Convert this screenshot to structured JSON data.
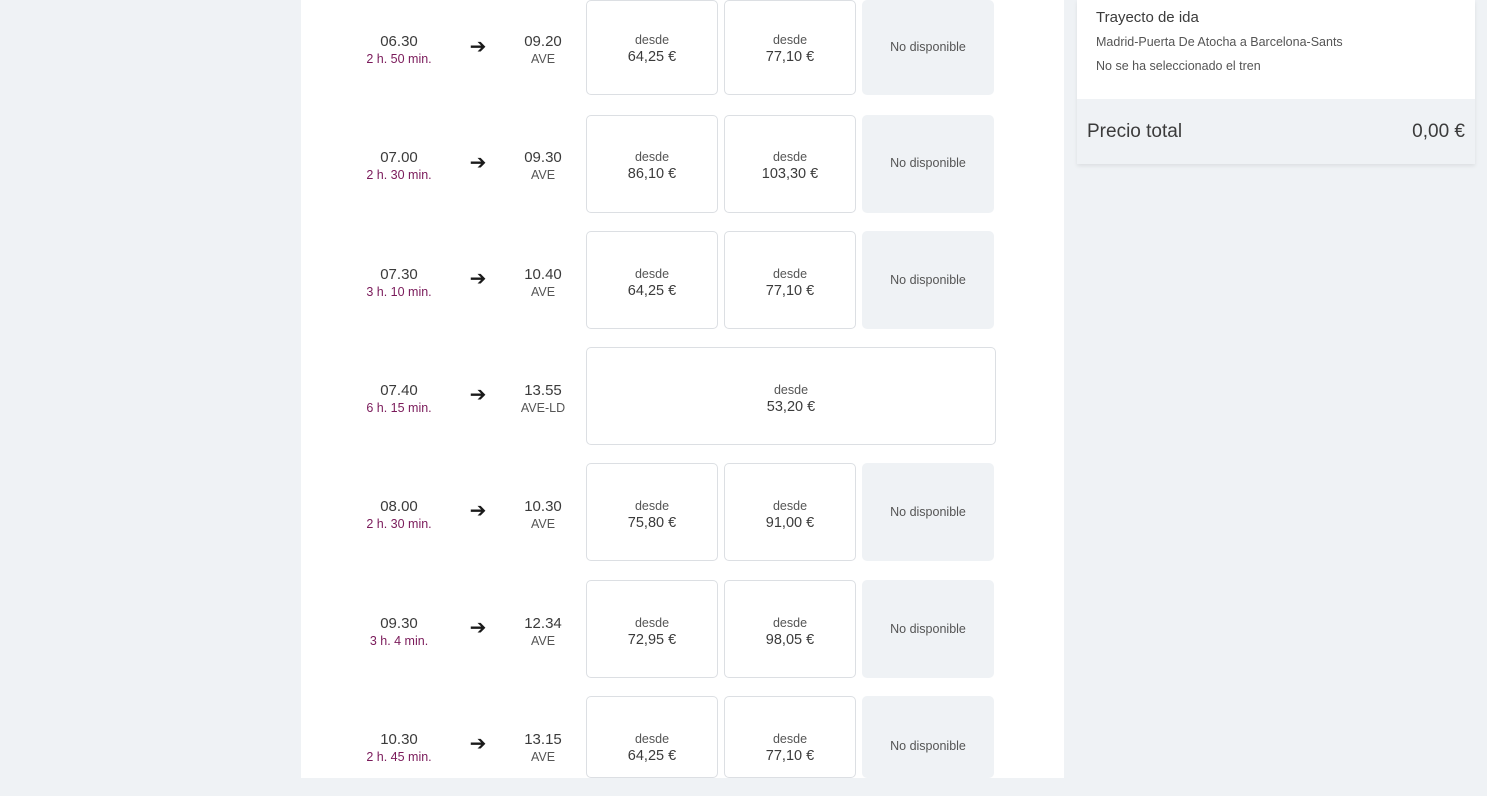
{
  "results": {
    "trips": [
      {
        "departure": "06.30",
        "duration": "2 h. 50 min.",
        "arrival": "09.20",
        "train": "AVE",
        "fares": [
          {
            "label": "desde",
            "price": "64,25 €"
          },
          {
            "label": "desde",
            "price": "77,10 €"
          },
          {
            "unavailable": "No disponible"
          }
        ]
      },
      {
        "departure": "07.00",
        "duration": "2 h. 30 min.",
        "arrival": "09.30",
        "train": "AVE",
        "fares": [
          {
            "label": "desde",
            "price": "86,10 €"
          },
          {
            "label": "desde",
            "price": "103,30 €"
          },
          {
            "unavailable": "No disponible"
          }
        ]
      },
      {
        "departure": "07.30",
        "duration": "3 h. 10 min.",
        "arrival": "10.40",
        "train": "AVE",
        "fares": [
          {
            "label": "desde",
            "price": "64,25 €"
          },
          {
            "label": "desde",
            "price": "77,10 €"
          },
          {
            "unavailable": "No disponible"
          }
        ]
      },
      {
        "departure": "07.40",
        "duration": "6 h. 15 min.",
        "arrival": "13.55",
        "train": "AVE-LD",
        "fares": [
          {
            "label": "desde",
            "price": "53,20 €"
          }
        ]
      },
      {
        "departure": "08.00",
        "duration": "2 h. 30 min.",
        "arrival": "10.30",
        "train": "AVE",
        "fares": [
          {
            "label": "desde",
            "price": "75,80 €"
          },
          {
            "label": "desde",
            "price": "91,00 €"
          },
          {
            "unavailable": "No disponible"
          }
        ]
      },
      {
        "departure": "09.30",
        "duration": "3 h. 4 min.",
        "arrival": "12.34",
        "train": "AVE",
        "fares": [
          {
            "label": "desde",
            "price": "72,95 €"
          },
          {
            "label": "desde",
            "price": "98,05 €"
          },
          {
            "unavailable": "No disponible"
          }
        ]
      },
      {
        "departure": "10.30",
        "duration": "2 h. 45 min.",
        "arrival": "13.15",
        "train": "AVE",
        "fares": [
          {
            "label": "desde",
            "price": "64,25 €"
          },
          {
            "label": "desde",
            "price": "77,10 €"
          },
          {
            "unavailable": "No disponible"
          }
        ]
      }
    ],
    "arrow_icon": "right-arrow-icon"
  },
  "summary": {
    "title": "Trayecto de ida",
    "route": "Madrid-Puerta De Atocha a Barcelona-Sants",
    "status": "No se ha seleccionado el tren",
    "total_label": "Precio total",
    "total_value": "0,00 €"
  },
  "colors": {
    "background": "#eff2f5",
    "duration_accent": "#7a1a5a",
    "unavailable_fill": "#eff2f5"
  }
}
